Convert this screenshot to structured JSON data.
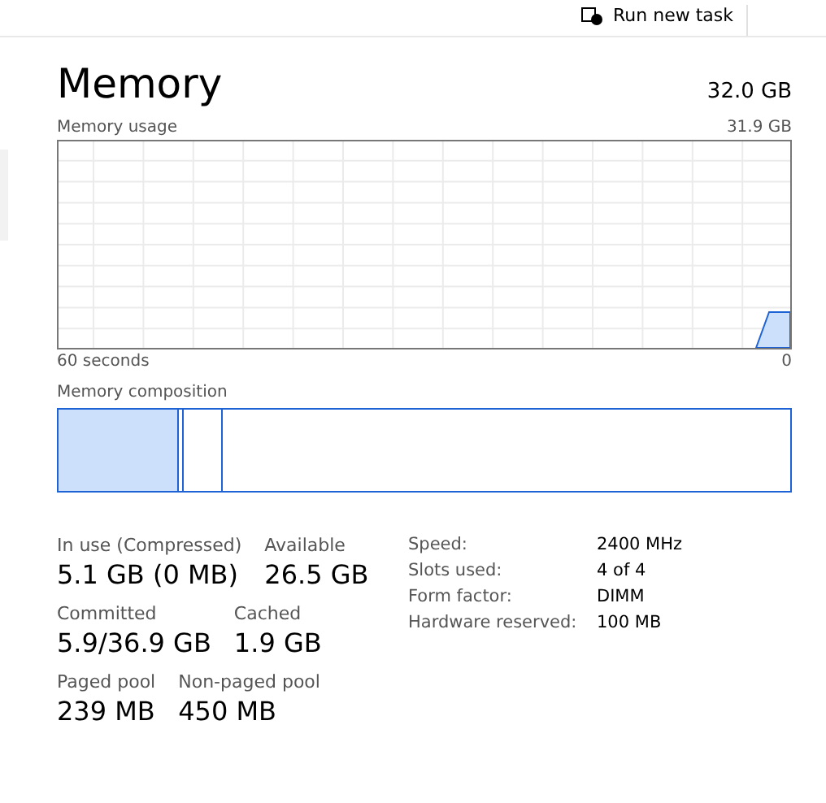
{
  "toolbar": {
    "run_task": "Run new task"
  },
  "header": {
    "title": "Memory",
    "total": "32.0 GB"
  },
  "usage": {
    "label": "Memory usage",
    "max": "31.9 GB",
    "left_axis": "60 seconds",
    "right_axis": "0"
  },
  "composition": {
    "label": "Memory composition"
  },
  "stats": [
    {
      "label": "In use (Compressed)",
      "value": "5.1 GB (0 MB)"
    },
    {
      "label": "Available",
      "value": "26.5 GB"
    },
    {
      "label": "Committed",
      "value": "5.9/36.9 GB"
    },
    {
      "label": "Cached",
      "value": "1.9 GB"
    },
    {
      "label": "Paged pool",
      "value": "239 MB"
    },
    {
      "label": "Non-paged pool",
      "value": "450 MB"
    }
  ],
  "details": [
    {
      "label": "Speed:",
      "value": "2400 MHz"
    },
    {
      "label": "Slots used:",
      "value": "4 of 4"
    },
    {
      "label": "Form factor:",
      "value": "DIMM"
    },
    {
      "label": "Hardware reserved:",
      "value": "100 MB"
    }
  ]
}
